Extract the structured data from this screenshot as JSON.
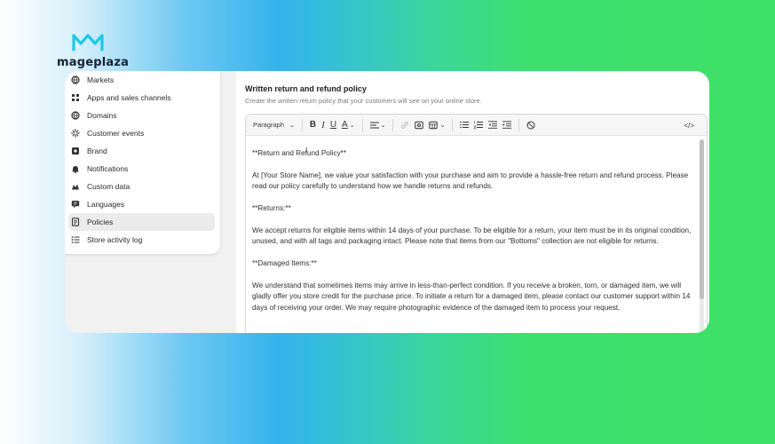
{
  "brand": {
    "name": "mageplaza",
    "accent": "#1ec8e6"
  },
  "sidebar": {
    "items": [
      {
        "label": "Markets",
        "icon": "globe-icon"
      },
      {
        "label": "Apps and sales channels",
        "icon": "apps-icon"
      },
      {
        "label": "Domains",
        "icon": "globe-icon"
      },
      {
        "label": "Customer events",
        "icon": "sparkle-icon"
      },
      {
        "label": "Brand",
        "icon": "brand-icon"
      },
      {
        "label": "Notifications",
        "icon": "bell-icon"
      },
      {
        "label": "Custom data",
        "icon": "data-icon"
      },
      {
        "label": "Languages",
        "icon": "language-icon"
      },
      {
        "label": "Policies",
        "icon": "policies-icon",
        "active": true
      },
      {
        "label": "Store activity log",
        "icon": "list-icon"
      }
    ]
  },
  "section": {
    "title": "Written return and refund policy",
    "subtitle": "Create the written return policy that your customers will see on your online store."
  },
  "toolbar": {
    "paragraph_select": "Paragraph",
    "bold": "B",
    "italic": "I",
    "underline": "U",
    "text_color": "A",
    "code": "</>"
  },
  "editor": {
    "paragraphs": [
      "**Return and Refund Policy**",
      "At [Your Store Name], we value your satisfaction with your purchase and aim to provide a hassle-free return and refund process. Please read our policy carefully to understand how we handle returns and refunds.",
      "**Returns:**",
      "We accept returns for eligible items within 14 days of your purchase. To be eligible for a return, your item must be in its original condition, unused, and with all tags and packaging intact. Please note that items from our \"Bottoms\" collection are not eligible for returns.",
      "**Damaged Items:**",
      "We understand that sometimes items may arrive in less-than-perfect condition. If you receive a broken, torn, or damaged item, we will gladly offer you store credit for the purchase price. To initiate a return for a damaged item, please contact our customer support within 14 days of receiving your order. We may require photographic evidence of the damaged item to process your request."
    ]
  }
}
